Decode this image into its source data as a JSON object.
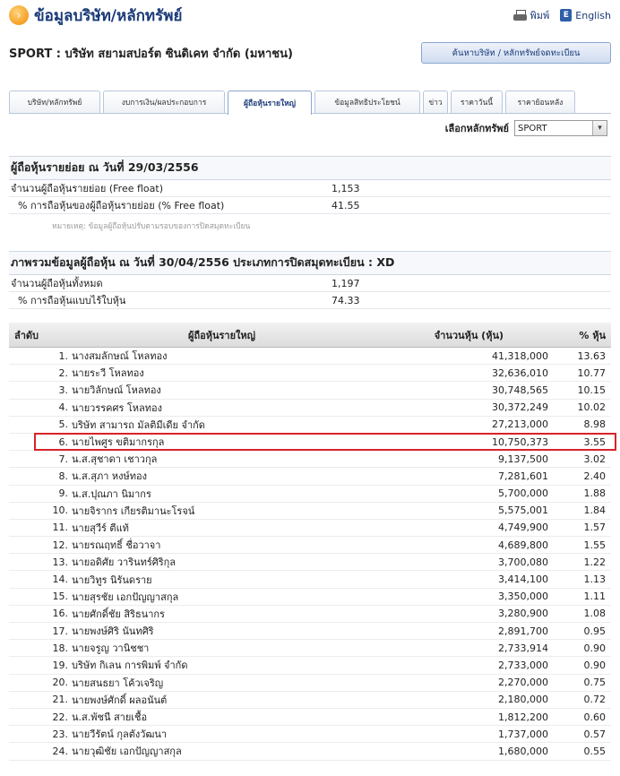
{
  "header": {
    "title": "ข้อมูลบริษัท/หลักทรัพย์",
    "print_label": "พิมพ์",
    "english_label": "English",
    "lang_icon_letter": "E"
  },
  "company": {
    "name": "SPORT : บริษัท สยามสปอร์ต ซินดิเคท จำกัด (มหาชน)",
    "search_button": "ค้นหาบริษัท / หลักทรัพย์จดทะเบียน"
  },
  "tabs": [
    {
      "label": "บริษัท/หลักทรัพย์",
      "active": false
    },
    {
      "label": "งบการเงิน/ผลประกอบการ",
      "active": false
    },
    {
      "label": "ผู้ถือหุ้นรายใหญ่",
      "active": true
    },
    {
      "label": "ข้อมูลสิทธิประโยชน์",
      "active": false
    },
    {
      "label": "ข่าว",
      "active": false
    },
    {
      "label": "ราคาวันนี้",
      "active": false
    },
    {
      "label": "ราคาย้อนหลัง",
      "active": false
    }
  ],
  "selector": {
    "label": "เลือกหลักทรัพย์",
    "value": "SPORT"
  },
  "free_float": {
    "title": "ผู้ถือหุ้นรายย่อย ณ วันที่ 29/03/2556",
    "rows": [
      {
        "label": "จำนวนผู้ถือหุ้นรายย่อย (Free float)",
        "value": "1,153"
      },
      {
        "label": "% การถือหุ้นของผู้ถือหุ้นรายย่อย (% Free float)",
        "value": "41.55"
      }
    ],
    "remark": "หมายเหตุ: ข้อมูลผู้ถือหุ้นปรับตามรอบของการปิดสมุดทะเบียน"
  },
  "overview": {
    "title": "ภาพรวมข้อมูลผู้ถือหุ้น ณ วันที่ 30/04/2556 ประเภทการปิดสมุดทะเบียน : XD",
    "rows": [
      {
        "label": "จำนวนผู้ถือหุ้นทั้งหมด",
        "value": "1,197"
      },
      {
        "label": "% การถือหุ้นแบบไร้ใบหุ้น",
        "value": "74.33"
      }
    ]
  },
  "holders": {
    "headers": {
      "rank": "ลำดับ",
      "name": "ผู้ถือหุ้นรายใหญ่",
      "shares": "จำนวนหุ้น (หุ้น)",
      "pct": "% หุ้น"
    },
    "highlighted_rank": 6,
    "rows": [
      {
        "rank": "1.",
        "name": "นางสมลักษณ์ โหลทอง",
        "shares": "41,318,000",
        "pct": "13.63"
      },
      {
        "rank": "2.",
        "name": "นายระวี โหลทอง",
        "shares": "32,636,010",
        "pct": "10.77"
      },
      {
        "rank": "3.",
        "name": "นายวิลักษณ์ โหลทอง",
        "shares": "30,748,565",
        "pct": "10.15"
      },
      {
        "rank": "4.",
        "name": "นายวรรคศร โหลทอง",
        "shares": "30,372,249",
        "pct": "10.02"
      },
      {
        "rank": "5.",
        "name": "บริษัท สามารถ มัลติมีเดีย จำกัด",
        "shares": "27,213,000",
        "pct": "8.98"
      },
      {
        "rank": "6.",
        "name": "นายไพศูร ขติมากรกุล",
        "shares": "10,750,373",
        "pct": "3.55"
      },
      {
        "rank": "7.",
        "name": "น.ส.สุชาดา เชาวกุล",
        "shares": "9,137,500",
        "pct": "3.02"
      },
      {
        "rank": "8.",
        "name": "น.ส.สุภา หงษ์ทอง",
        "shares": "7,281,601",
        "pct": "2.40"
      },
      {
        "rank": "9.",
        "name": "น.ส.ปุณภา นิมากร",
        "shares": "5,700,000",
        "pct": "1.88"
      },
      {
        "rank": "10.",
        "name": "นายจิรากร เกียรติมานะโรจน์",
        "shares": "5,575,001",
        "pct": "1.84"
      },
      {
        "rank": "11.",
        "name": "นายสุวีร์ ตีแท้",
        "shares": "4,749,900",
        "pct": "1.57"
      },
      {
        "rank": "12.",
        "name": "นายรณฤทธิ์ ชื่อวาจา",
        "shares": "4,689,800",
        "pct": "1.55"
      },
      {
        "rank": "13.",
        "name": "นายอดิศัย วารินทร์ศิริกุล",
        "shares": "3,700,080",
        "pct": "1.22"
      },
      {
        "rank": "14.",
        "name": "นายวิทูร นิรันดราย",
        "shares": "3,414,100",
        "pct": "1.13"
      },
      {
        "rank": "15.",
        "name": "นายสุรชัย เอกปัญญาสกุล",
        "shares": "3,350,000",
        "pct": "1.11"
      },
      {
        "rank": "16.",
        "name": "นายศักดิ์ชัย สิริธนากร",
        "shares": "3,280,900",
        "pct": "1.08"
      },
      {
        "rank": "17.",
        "name": "นายพงษ์ศิริ นันทศิริ",
        "shares": "2,891,700",
        "pct": "0.95"
      },
      {
        "rank": "18.",
        "name": "นายจรูญ วานิชชา",
        "shares": "2,733,914",
        "pct": "0.90"
      },
      {
        "rank": "19.",
        "name": "บริษัท กิเลน การพิมพ์ จำกัด",
        "shares": "2,733,000",
        "pct": "0.90"
      },
      {
        "rank": "20.",
        "name": "นายสนธยา โค้วเจริญ",
        "shares": "2,270,000",
        "pct": "0.75"
      },
      {
        "rank": "21.",
        "name": "นายพงษ์ศักดิ์ ผลอนันต์",
        "shares": "2,180,000",
        "pct": "0.72"
      },
      {
        "rank": "22.",
        "name": "น.ส.พัชนี สายเชื้อ",
        "shares": "1,812,200",
        "pct": "0.60"
      },
      {
        "rank": "23.",
        "name": "นายวีรัตน์ กุลตังวัฒนา",
        "shares": "1,737,000",
        "pct": "0.57"
      },
      {
        "rank": "24.",
        "name": "นายวุฒิชัย เอกปัญญาสกุล",
        "shares": "1,680,000",
        "pct": "0.55"
      }
    ]
  }
}
